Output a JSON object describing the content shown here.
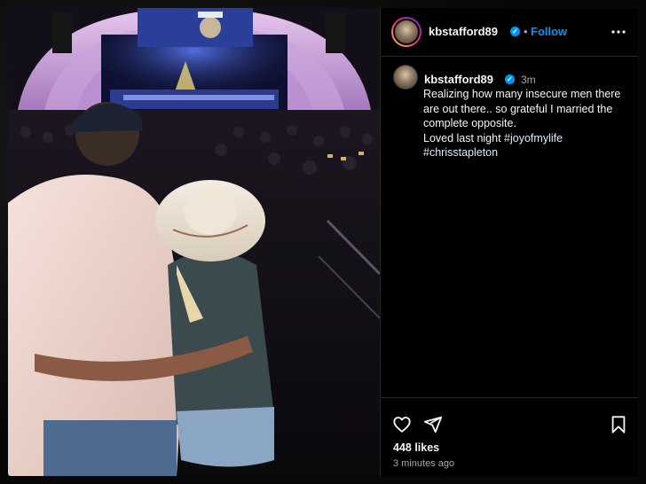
{
  "post": {
    "username": "kbstafford89",
    "verified_badge": "✓",
    "separator": "•",
    "follow_label": "Follow",
    "more_icon": "more-horizontal-icon",
    "caption_username": "kbstafford89",
    "caption_time": "3m",
    "caption_lines": [
      "Realizing how many insecure men there",
      "are out there.. so grateful I married the",
      "complete opposite."
    ],
    "caption_line4_text": "Loved last night ",
    "hashtags": [
      "#joyofmylife",
      "#chrisstapleton"
    ],
    "likes": "448 likes",
    "time_ago": "3 minutes ago"
  },
  "actions": {
    "like_icon": "heart-icon",
    "share_icon": "send-icon",
    "save_icon": "bookmark-icon"
  },
  "colors": {
    "accent": "#0095f6",
    "text": "#f5f5f5",
    "muted": "#a8a8a8",
    "panel_bg": "#000000",
    "divider": "#262626"
  }
}
